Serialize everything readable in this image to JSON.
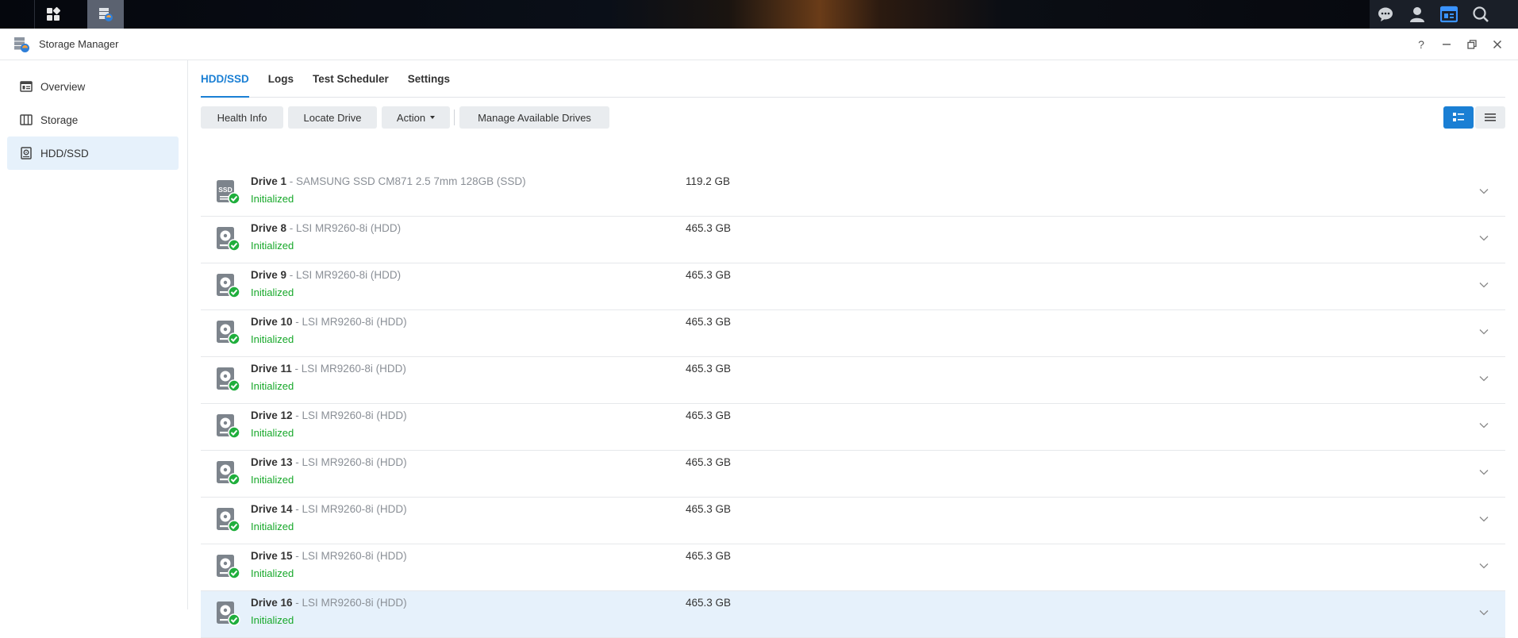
{
  "window": {
    "title": "Storage Manager"
  },
  "sidebar": {
    "items": [
      {
        "label": "Overview",
        "icon": "overview-icon",
        "selected": false
      },
      {
        "label": "Storage",
        "icon": "storage-icon",
        "selected": false
      },
      {
        "label": "HDD/SSD",
        "icon": "drive-icon",
        "selected": true
      }
    ]
  },
  "tabs": [
    {
      "label": "HDD/SSD",
      "active": true
    },
    {
      "label": "Logs",
      "active": false
    },
    {
      "label": "Test Scheduler",
      "active": false
    },
    {
      "label": "Settings",
      "active": false
    }
  ],
  "toolbar": {
    "health_info": "Health Info",
    "locate_drive": "Locate Drive",
    "action": "Action",
    "manage_drives": "Manage Available Drives"
  },
  "drives": [
    {
      "name": "Drive 1",
      "model": " - SAMSUNG SSD CM871 2.5 7mm 128GB (SSD)",
      "status": "Initialized",
      "size": "119.2 GB",
      "type": "ssd",
      "selected": false
    },
    {
      "name": "Drive 8",
      "model": " - LSI MR9260-8i (HDD)",
      "status": "Initialized",
      "size": "465.3 GB",
      "type": "hdd",
      "selected": false
    },
    {
      "name": "Drive 9",
      "model": " - LSI MR9260-8i (HDD)",
      "status": "Initialized",
      "size": "465.3 GB",
      "type": "hdd",
      "selected": false
    },
    {
      "name": "Drive 10",
      "model": " - LSI MR9260-8i (HDD)",
      "status": "Initialized",
      "size": "465.3 GB",
      "type": "hdd",
      "selected": false
    },
    {
      "name": "Drive 11",
      "model": " - LSI MR9260-8i (HDD)",
      "status": "Initialized",
      "size": "465.3 GB",
      "type": "hdd",
      "selected": false
    },
    {
      "name": "Drive 12",
      "model": " - LSI MR9260-8i (HDD)",
      "status": "Initialized",
      "size": "465.3 GB",
      "type": "hdd",
      "selected": false
    },
    {
      "name": "Drive 13",
      "model": " - LSI MR9260-8i (HDD)",
      "status": "Initialized",
      "size": "465.3 GB",
      "type": "hdd",
      "selected": false
    },
    {
      "name": "Drive 14",
      "model": " - LSI MR9260-8i (HDD)",
      "status": "Initialized",
      "size": "465.3 GB",
      "type": "hdd",
      "selected": false
    },
    {
      "name": "Drive 15",
      "model": " - LSI MR9260-8i (HDD)",
      "status": "Initialized",
      "size": "465.3 GB",
      "type": "hdd",
      "selected": false
    },
    {
      "name": "Drive 16",
      "model": " - LSI MR9260-8i (HDD)",
      "status": "Initialized",
      "size": "465.3 GB",
      "type": "hdd",
      "selected": true
    }
  ],
  "ssd_icon_text": "SSD",
  "colors": {
    "accent": "#1a7fd4",
    "success": "#17a82a",
    "selected_bg": "#e6f1fb"
  }
}
